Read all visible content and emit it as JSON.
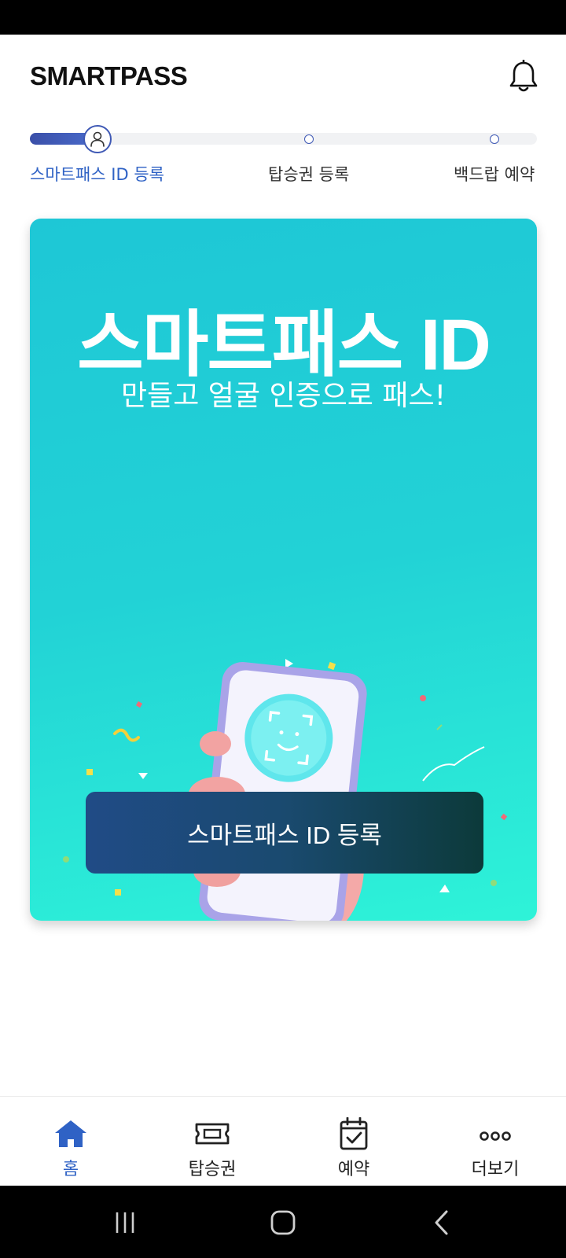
{
  "app": {
    "title": "SMARTPASS"
  },
  "colors": {
    "accent": "#2f62c5",
    "card_top": "#1ec7d6",
    "card_bottom": "#2ef3d8",
    "button_left": "#204b86",
    "button_right": "#0c3a3a"
  },
  "progress": {
    "current_step": 1,
    "steps": [
      {
        "label": "스마트패스 ID 등록",
        "active": true
      },
      {
        "label": "탑승권 등록",
        "active": false
      },
      {
        "label": "백드랍 예약",
        "active": false
      }
    ]
  },
  "promo": {
    "title": "스마트패스 ID",
    "subtitle": "만들고 얼굴 인증으로 패스!",
    "button_label": "스마트패스 ID 등록",
    "illustration_icon": "phone-face-id-icon"
  },
  "bottom_nav": {
    "items": [
      {
        "label": "홈",
        "icon": "home-icon",
        "active": true
      },
      {
        "label": "탑승권",
        "icon": "ticket-icon",
        "active": false
      },
      {
        "label": "예약",
        "icon": "calendar-check-icon",
        "active": false
      },
      {
        "label": "더보기",
        "icon": "more-icon",
        "active": false
      }
    ]
  },
  "system_nav": {
    "icons": [
      "recent-apps-icon",
      "home-circle-icon",
      "back-icon"
    ]
  }
}
